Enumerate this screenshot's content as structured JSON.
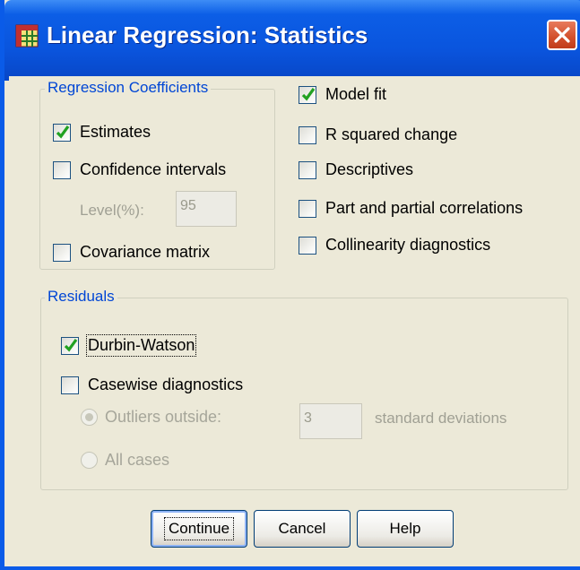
{
  "window": {
    "title": "Linear Regression: Statistics",
    "title_bar_color": "#0a55de",
    "close_button_color": "#d24f2b"
  },
  "regression_coefficients": {
    "group_label": "Regression Coefficients",
    "estimates": {
      "label": "Estimates",
      "checked": true
    },
    "confidence_intervals": {
      "label": "Confidence intervals",
      "checked": false
    },
    "level_label": "Level(%):",
    "level_value": "95",
    "covariance_matrix": {
      "label": "Covariance matrix",
      "checked": false
    }
  },
  "options": {
    "model_fit": {
      "label": "Model fit",
      "checked": true
    },
    "r_squared_change": {
      "label": "R squared change",
      "checked": false
    },
    "descriptives": {
      "label": "Descriptives",
      "checked": false
    },
    "part_partial": {
      "label": "Part and partial correlations",
      "checked": false
    },
    "collinearity": {
      "label": "Collinearity diagnostics",
      "checked": false
    }
  },
  "residuals": {
    "group_label": "Residuals",
    "durbin_watson": {
      "label": "Durbin-Watson",
      "checked": true
    },
    "casewise": {
      "label": "Casewise diagnostics",
      "checked": false
    },
    "outliers_outside": {
      "label": "Outliers outside:",
      "selected": true,
      "enabled": false
    },
    "outliers_value": "3",
    "std_dev_label": "standard deviations",
    "all_cases": {
      "label": "All cases",
      "selected": false,
      "enabled": false
    }
  },
  "buttons": {
    "continue": "Continue",
    "cancel": "Cancel",
    "help": "Help"
  },
  "icons": {
    "app": "spss-grid-icon",
    "close": "close-x-icon",
    "check": "checkmark-icon"
  }
}
